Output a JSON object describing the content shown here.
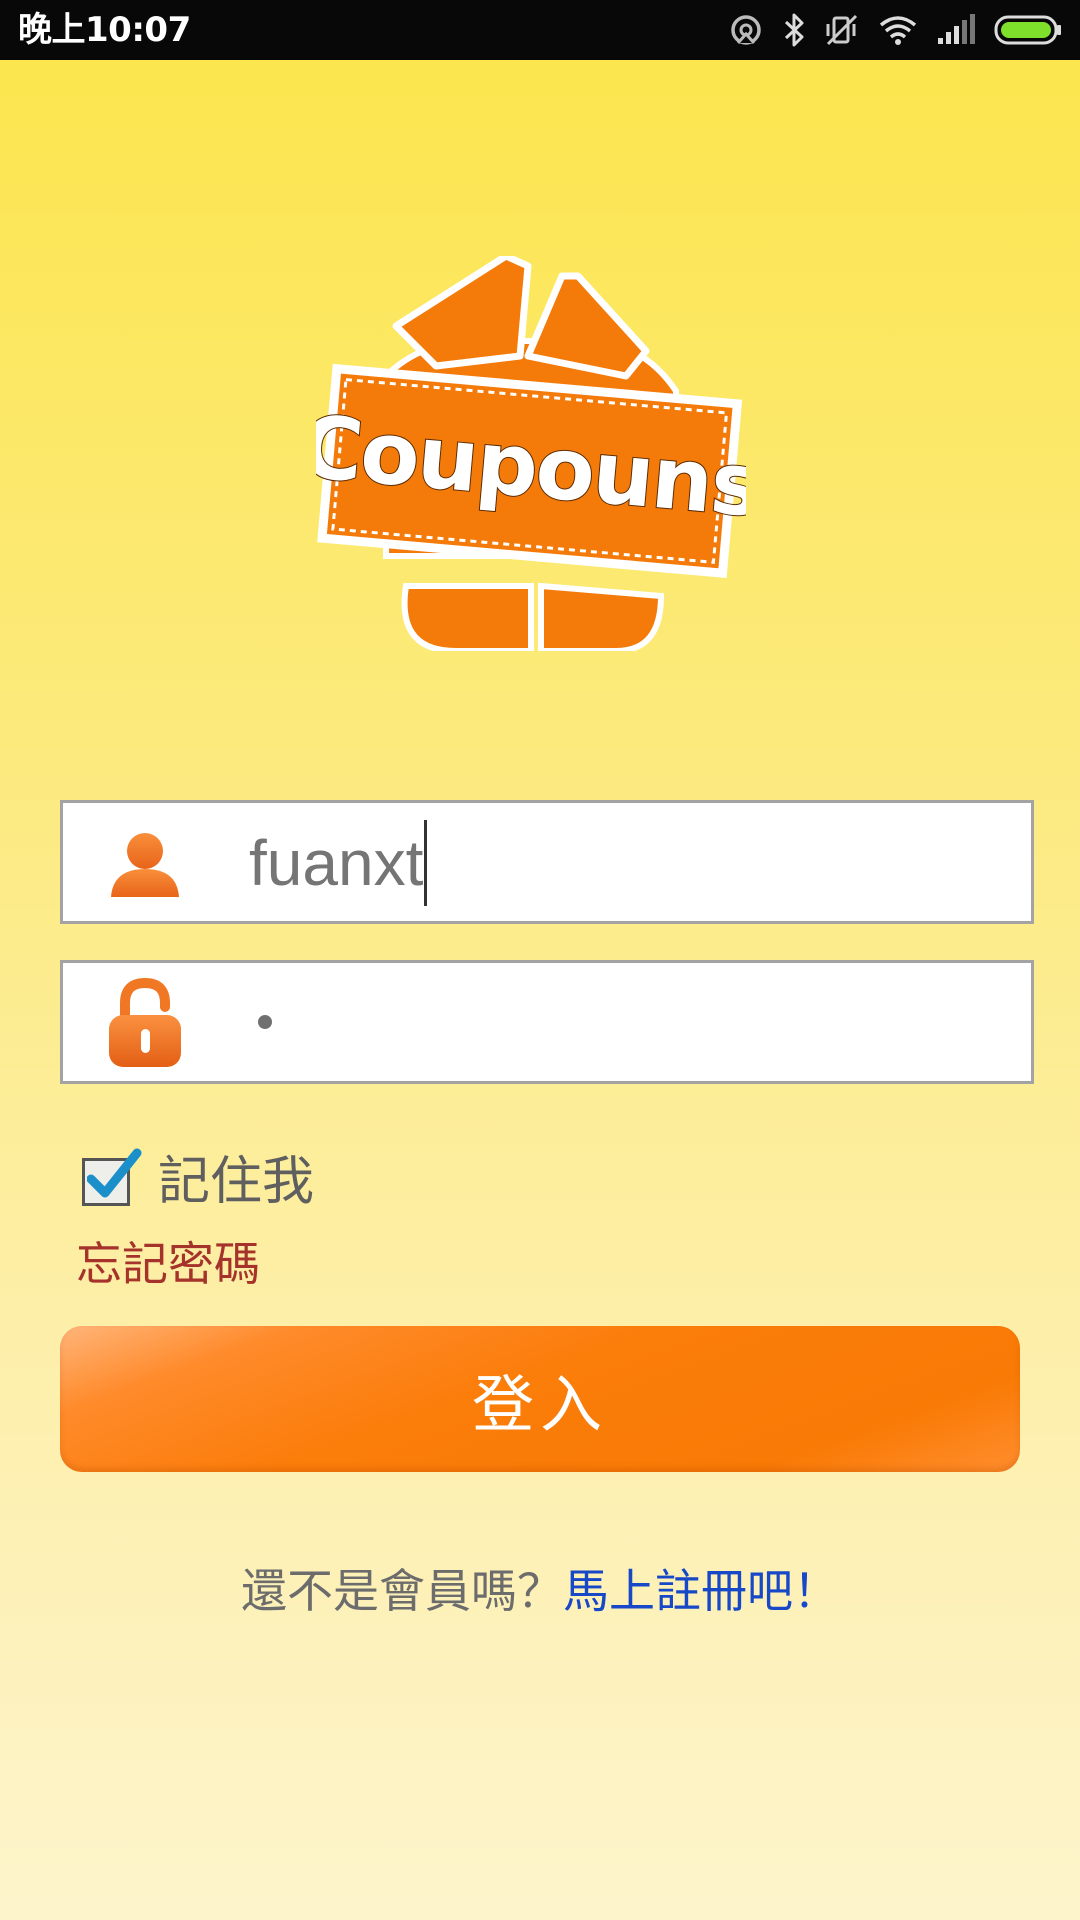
{
  "status_bar": {
    "time": "晚上10:07",
    "icons": [
      "sync-icon",
      "bluetooth-icon",
      "silent-icon",
      "wifi-icon",
      "signal-icon",
      "battery-icon"
    ],
    "battery_color": "#7ee02a"
  },
  "logo": {
    "text": "Coupouns",
    "color": "#f47a09"
  },
  "login_form": {
    "username_value": "fuanxt",
    "password_mask": "•",
    "remember_me_label": "記住我",
    "remember_me_checked": true,
    "forgot_password_label": "忘記密碼",
    "login_button_label": "登入"
  },
  "register": {
    "prompt": "還不是會員嗎？",
    "link": "馬上註冊吧！"
  },
  "colors": {
    "accent": "#fb7d0a",
    "link": "#1648c8",
    "forgot": "#a5332b",
    "background_top": "#fce54a",
    "background_bottom": "#fdf4cc"
  }
}
